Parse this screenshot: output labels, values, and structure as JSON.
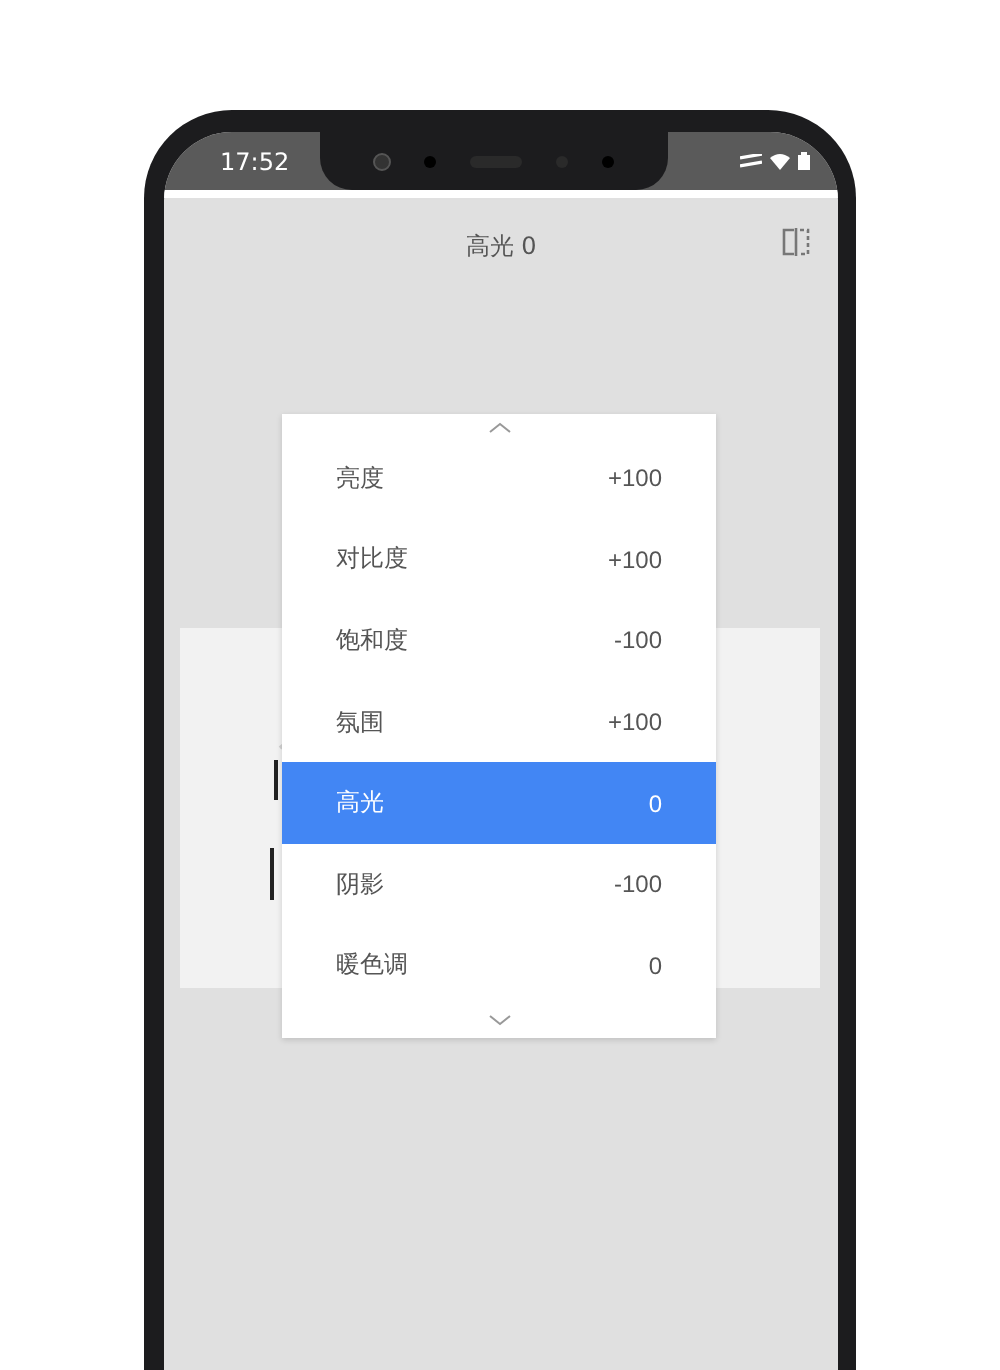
{
  "status_bar": {
    "time": "17:52"
  },
  "header": {
    "title": "高光 0"
  },
  "menu": {
    "items": [
      {
        "label": "亮度",
        "value": "+100",
        "selected": false
      },
      {
        "label": "对比度",
        "value": "+100",
        "selected": false
      },
      {
        "label": "饱和度",
        "value": "-100",
        "selected": false
      },
      {
        "label": "氛围",
        "value": "+100",
        "selected": false
      },
      {
        "label": "高光",
        "value": "0",
        "selected": true
      },
      {
        "label": "阴影",
        "value": "-100",
        "selected": false
      },
      {
        "label": "暖色调",
        "value": "0",
        "selected": false
      }
    ]
  }
}
